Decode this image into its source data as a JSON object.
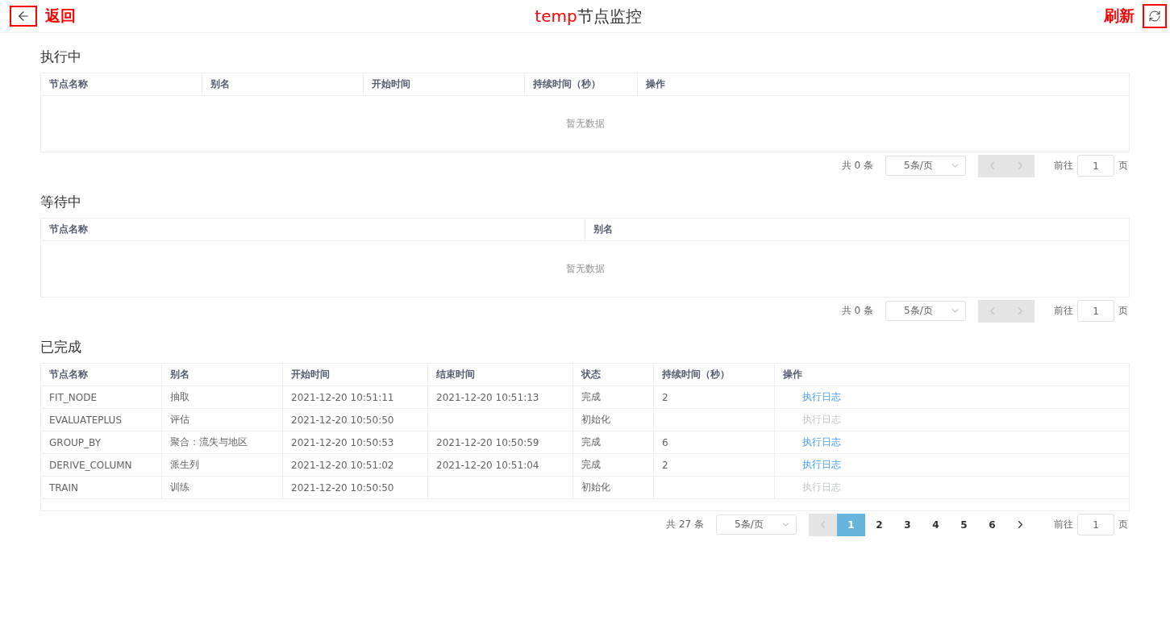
{
  "header": {
    "back_label": "返回",
    "title_highlight": "temp",
    "title": "节点监控",
    "refresh_label": "刷新"
  },
  "sections": [
    {
      "title": "执行中",
      "columns": [
        "节点名称",
        "别名",
        "开始时间",
        "持续时间（秒）",
        "操作"
      ],
      "empty_text": "暂无数据",
      "pager": {
        "total": "共 0 条",
        "page_size": "5条/页",
        "prev_disabled": true,
        "next_disabled": true,
        "goto_label": "前往",
        "goto_value": "1",
        "goto_suffix": "页"
      }
    },
    {
      "title": "等待中",
      "columns": [
        "节点名称",
        "别名"
      ],
      "empty_text": "暂无数据",
      "pager": {
        "total": "共 0 条",
        "page_size": "5条/页",
        "prev_disabled": true,
        "next_disabled": true,
        "goto_label": "前往",
        "goto_value": "1",
        "goto_suffix": "页"
      }
    },
    {
      "title": "已完成",
      "columns": [
        "节点名称",
        "别名",
        "开始时间",
        "结束时间",
        "状态",
        "持续时间（秒）",
        "操作"
      ],
      "rows": [
        {
          "cells": [
            "FIT_NODE",
            "抽取",
            "2021-12-20 10:51:11",
            "2021-12-20 10:51:13",
            "完成",
            "2"
          ],
          "action": "执行日志",
          "action_disabled": false
        },
        {
          "cells": [
            "EVALUATEPLUS",
            "评估",
            "2021-12-20 10:50:50",
            "",
            "初始化",
            ""
          ],
          "action": "执行日志",
          "action_disabled": true
        },
        {
          "cells": [
            "GROUP_BY",
            "聚合：流失与地区",
            "2021-12-20 10:50:53",
            "2021-12-20 10:50:59",
            "完成",
            "6"
          ],
          "action": "执行日志",
          "action_disabled": false
        },
        {
          "cells": [
            "DERIVE_COLUMN",
            "派生列",
            "2021-12-20 10:51:02",
            "2021-12-20 10:51:04",
            "完成",
            "2"
          ],
          "action": "执行日志",
          "action_disabled": false
        },
        {
          "cells": [
            "TRAIN",
            "训练",
            "2021-12-20 10:50:50",
            "",
            "初始化",
            ""
          ],
          "action": "执行日志",
          "action_disabled": true
        }
      ],
      "pager": {
        "total": "共 27 条",
        "page_size": "5条/页",
        "prev_disabled": true,
        "next_disabled": false,
        "pages": [
          {
            "label": "1",
            "selected": true
          },
          {
            "label": "2",
            "selected": false
          },
          {
            "label": "3",
            "selected": false
          },
          {
            "label": "4",
            "selected": false
          },
          {
            "label": "5",
            "selected": false
          },
          {
            "label": "6",
            "selected": false
          }
        ],
        "goto_label": "前往",
        "goto_value": "1",
        "goto_suffix": "页"
      }
    }
  ]
}
